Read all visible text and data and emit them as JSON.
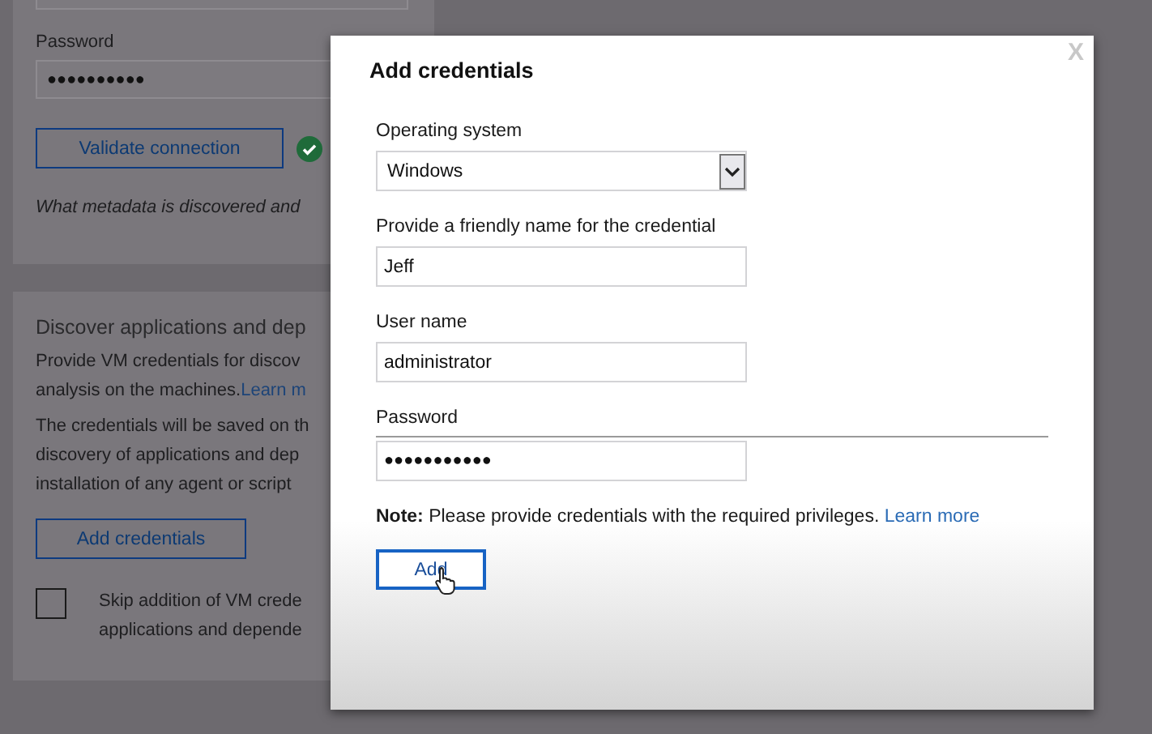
{
  "background": {
    "password_label": "Password",
    "password_value": "●●●●●●●●●●",
    "validate_button": "Validate connection",
    "validated": true,
    "metadata_note": "What metadata is discovered and",
    "discover_heading": "Discover applications and dep",
    "paragraph1": [
      "Provide VM credentials for discov",
      "analysis on the machines."
    ],
    "paragraph1_link": "Learn m",
    "paragraph2": [
      "The credentials will be saved on th",
      "discovery of applications and dep",
      "installation of any agent or script"
    ],
    "add_credentials_button": "Add credentials",
    "skip_option": {
      "checked": false,
      "lines": [
        "Skip addition of VM crede",
        "applications and depende"
      ]
    }
  },
  "dialog": {
    "title": "Add credentials",
    "close": "X",
    "fields": [
      {
        "kind": "select",
        "label": "Operating system",
        "value": "Windows"
      },
      {
        "kind": "text",
        "label": "Provide a friendly name for the credential",
        "value": "Jeff"
      },
      {
        "kind": "text",
        "label": "User name",
        "value": "administrator"
      },
      {
        "kind": "password",
        "label": "Password",
        "value": "●●●●●●●●●●●"
      }
    ],
    "note": "**Note:** Please provide credentials with the required privileges.",
    "note_link": "Learn more",
    "add_button": "Add"
  }
}
